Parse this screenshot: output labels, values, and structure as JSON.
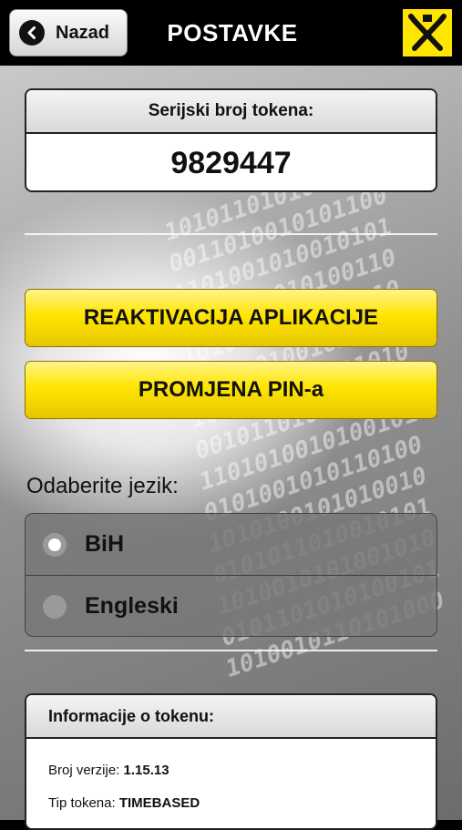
{
  "header": {
    "back_label": "Nazad",
    "title": "POSTAVKE",
    "logo_icon": "raiffeisen-logo-icon",
    "logo_color": "#ffe600"
  },
  "serial": {
    "heading": "Serijski broj tokena:",
    "value": "9829447"
  },
  "actions": {
    "reactivate_label": "REAKTIVACIJA APLIKACIJE",
    "change_pin_label": "PROMJENA PIN-a",
    "accent_color": "#ffe500"
  },
  "language": {
    "prompt": "Odaberite jezik:",
    "options": [
      {
        "label": "BiH",
        "selected": true
      },
      {
        "label": "Engleski",
        "selected": false
      }
    ]
  },
  "token_info": {
    "heading": "Informacije o tokenu:",
    "version_label": "Broj verzije:",
    "version_value": "1.15.13",
    "type_label": "Tip tokena:",
    "type_value": "TIMEBASED"
  }
}
